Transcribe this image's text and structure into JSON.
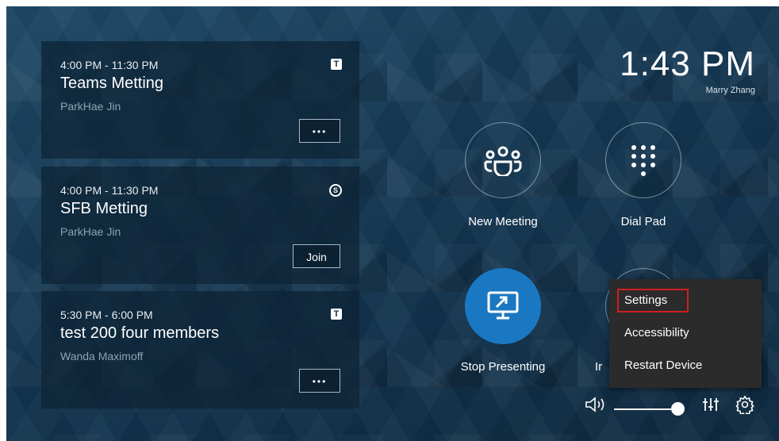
{
  "meetings": [
    {
      "time": "4:00 PM - 11:30 PM",
      "title": "Teams Metting",
      "organizer": "ParkHae Jin",
      "service": "teams",
      "service_glyph": "T",
      "action": "•••"
    },
    {
      "time": "4:00 PM - 11:30 PM",
      "title": "SFB Metting",
      "organizer": "ParkHae Jin",
      "service": "skype",
      "service_glyph": "S",
      "action": "Join"
    },
    {
      "time": "5:30 PM - 6:00 PM",
      "title": "test 200 four members",
      "organizer": "Wanda Maximoff",
      "service": "teams",
      "service_glyph": "T",
      "action": "•••"
    }
  ],
  "clock": {
    "time": "1:43 PM",
    "user": "Marry Zhang"
  },
  "tiles": {
    "new_meeting": "New Meeting",
    "dial_pad": "Dial Pad",
    "stop_presenting": "Stop Presenting",
    "partial_label": "Ir"
  },
  "menu": {
    "items": [
      "Settings",
      "Accessibility",
      "Restart Device"
    ],
    "selected": "Settings"
  },
  "colors": {
    "accent": "#1a78c2",
    "highlight": "#d0201e",
    "menu_bg": "#2b2b2b"
  },
  "volume": {
    "level": 0.95
  }
}
